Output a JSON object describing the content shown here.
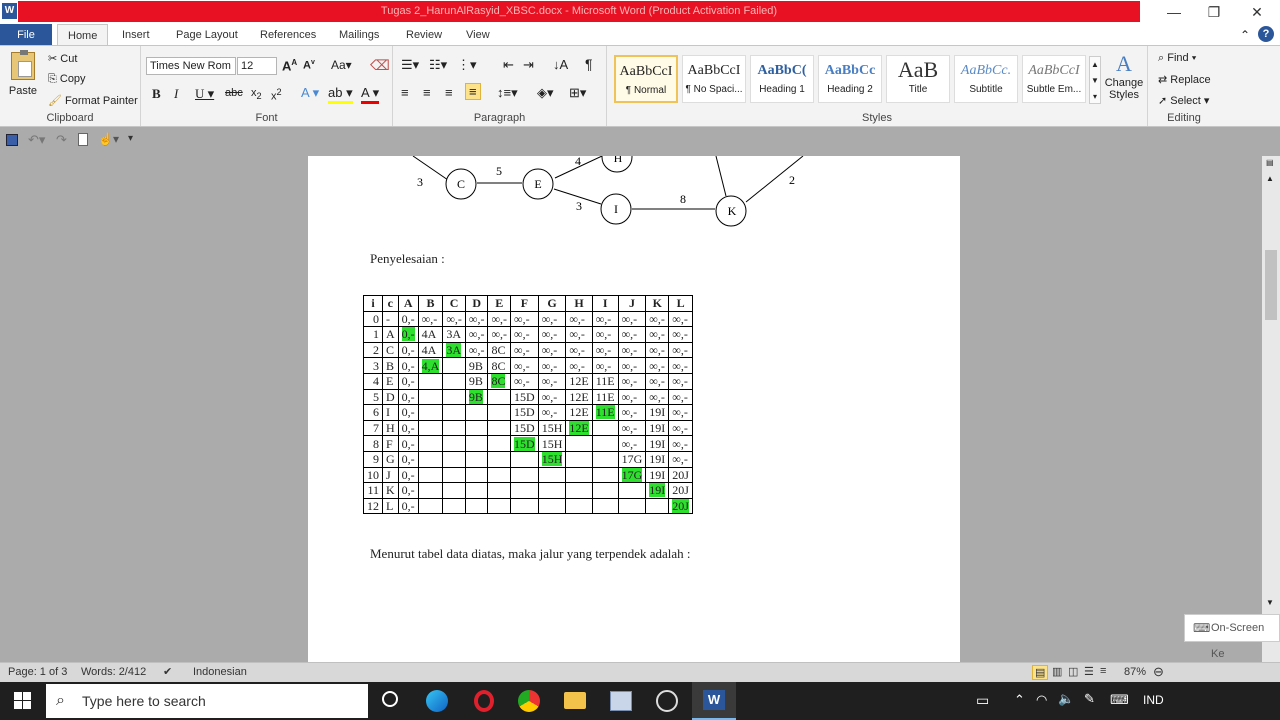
{
  "window": {
    "title": "Tugas 2_HarunAlRasyid_XBSC.docx  -  Microsoft Word (Product Activation Failed)",
    "app_icon_letter": "W"
  },
  "tabs": [
    "File",
    "Home",
    "Insert",
    "Page Layout",
    "References",
    "Mailings",
    "Review",
    "View"
  ],
  "ribbon": {
    "clipboard": {
      "paste": "Paste",
      "cut": "Cut",
      "copy": "Copy",
      "format_painter": "Format Painter",
      "label": "Clipboard"
    },
    "font": {
      "name": "Times New Rom",
      "size": "12",
      "label": "Font"
    },
    "paragraph": {
      "label": "Paragraph"
    },
    "styles": {
      "items": [
        {
          "preview": "AaBbCcI",
          "name": "¶ Normal"
        },
        {
          "preview": "AaBbCcI",
          "name": "¶ No Spaci..."
        },
        {
          "preview": "AaBbC(",
          "name": "Heading 1"
        },
        {
          "preview": "AaBbCc",
          "name": "Heading 2"
        },
        {
          "preview": "AaB",
          "name": "Title"
        },
        {
          "preview": "AaBbCc.",
          "name": "Subtitle"
        },
        {
          "preview": "AaBbCcI",
          "name": "Subtle Em..."
        }
      ],
      "change_styles": "Change Styles",
      "label": "Styles"
    },
    "editing": {
      "find": "Find",
      "replace": "Replace",
      "select": "Select",
      "label": "Editing"
    }
  },
  "document": {
    "graph": {
      "nodes": [
        "C",
        "E",
        "H",
        "I",
        "K"
      ],
      "edge_labels": [
        "3",
        "5",
        "4",
        "3",
        "8",
        "2"
      ]
    },
    "heading": "Penyelesaian :",
    "table": {
      "headers": [
        "i",
        "c",
        "A",
        "B",
        "C",
        "D",
        "E",
        "F",
        "G",
        "H",
        "I",
        "J",
        "K",
        "L"
      ],
      "rows": [
        [
          "0",
          "-",
          "0,-",
          "∞,-",
          "∞,-",
          "∞,-",
          "∞,-",
          "∞,-",
          "∞,-",
          "∞,-",
          "∞,-",
          "∞,-",
          "∞,-",
          "∞,-"
        ],
        [
          "1",
          "A",
          "0,-",
          "4A",
          "3A",
          "∞,-",
          "∞,-",
          "∞,-",
          "∞,-",
          "∞,-",
          "∞,-",
          "∞,-",
          "∞,-",
          "∞,-"
        ],
        [
          "2",
          "C",
          "0,-",
          "4A",
          "3A",
          "∞,-",
          "8C",
          "∞,-",
          "∞,-",
          "∞,-",
          "∞,-",
          "∞,-",
          "∞,-",
          "∞,-"
        ],
        [
          "3",
          "B",
          "0,-",
          "4,A",
          "",
          "9B",
          "8C",
          "∞,-",
          "∞,-",
          "∞,-",
          "∞,-",
          "∞,-",
          "∞,-",
          "∞,-"
        ],
        [
          "4",
          "E",
          "0,-",
          "",
          "",
          "9B",
          "8C",
          "∞,-",
          "∞,-",
          "12E",
          "11E",
          "∞,-",
          "∞,-",
          "∞,-"
        ],
        [
          "5",
          "D",
          "0,-",
          "",
          "",
          "9B",
          "",
          "15D",
          "∞,-",
          "12E",
          "11E",
          "∞,-",
          "∞,-",
          "∞,-"
        ],
        [
          "6",
          "I",
          "0,-",
          "",
          "",
          "",
          "",
          "15D",
          "∞,-",
          "12E",
          "11E",
          "∞,-",
          "19I",
          "∞,-"
        ],
        [
          "7",
          "H",
          "0,-",
          "",
          "",
          "",
          "",
          "15D",
          "15H",
          "12E",
          "",
          "∞,-",
          "19I",
          "∞,-"
        ],
        [
          "8",
          "F",
          "0,-",
          "",
          "",
          "",
          "",
          "15D",
          "15H",
          "",
          "",
          "∞,-",
          "19I",
          "∞,-"
        ],
        [
          "9",
          "G",
          "0,-",
          "",
          "",
          "",
          "",
          "",
          "15H",
          "",
          "",
          "17G",
          "19I",
          "∞,-"
        ],
        [
          "10",
          "J",
          "0,-",
          "",
          "",
          "",
          "",
          "",
          "",
          "",
          "",
          "17G",
          "19I",
          "20J"
        ],
        [
          "11",
          "K",
          "0,-",
          "",
          "",
          "",
          "",
          "",
          "",
          "",
          "",
          "",
          "19I",
          "20J"
        ],
        [
          "12",
          "L",
          "0,-",
          "",
          "",
          "",
          "",
          "",
          "",
          "",
          "",
          "",
          "",
          "20J"
        ]
      ],
      "highlights": [
        [
          1,
          2
        ],
        [
          2,
          4
        ],
        [
          3,
          3
        ],
        [
          4,
          6
        ],
        [
          5,
          5
        ],
        [
          6,
          10
        ],
        [
          7,
          9
        ],
        [
          8,
          7
        ],
        [
          9,
          8
        ],
        [
          10,
          11
        ],
        [
          11,
          12
        ],
        [
          12,
          13
        ]
      ],
      "highlight_color": "#2ee02e"
    },
    "conclusion": "Menurut tabel data diatas, maka jalur yang terpendek adalah :"
  },
  "status": {
    "page": "Page: 1 of 3",
    "words": "Words: 2/412",
    "language": "Indonesian",
    "zoom": "87%"
  },
  "taskbar": {
    "search_placeholder": "Type here to search",
    "lang": "IND"
  },
  "osk": {
    "label": "On-Screen Ke"
  }
}
